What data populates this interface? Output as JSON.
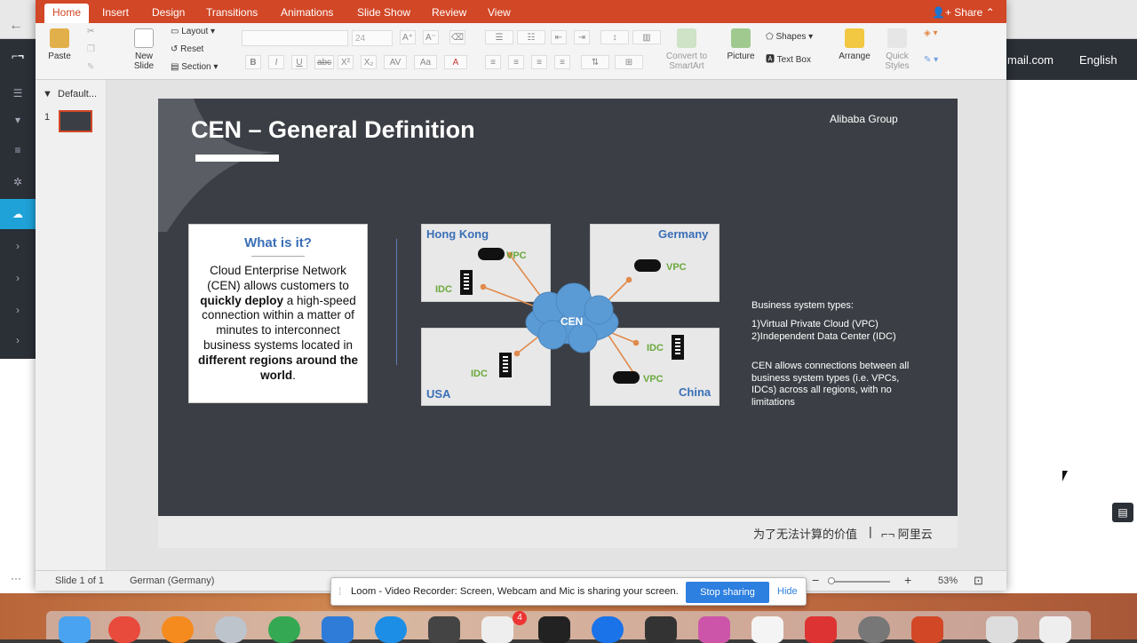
{
  "browser": {
    "nav_right": [
      "mail.com",
      "English"
    ],
    "email_text": "mail.com",
    "lang_text": "English"
  },
  "ppt": {
    "tabs": [
      "Home",
      "Insert",
      "Design",
      "Transitions",
      "Animations",
      "Slide Show",
      "Review",
      "View"
    ],
    "share_label": "Share",
    "ribbon": {
      "paste": "Paste",
      "new_slide": "New\nSlide",
      "layout": "Layout",
      "reset": "Reset",
      "section": "Section",
      "font_size": "24",
      "convert": "Convert to\nSmartArt",
      "picture": "Picture",
      "shapes": "Shapes",
      "textbox": "Text Box",
      "arrange": "Arrange",
      "quick_styles": "Quick\nStyles"
    },
    "thumb_section": "Default...",
    "thumb_num": "1",
    "status": {
      "slide": "Slide 1 of 1",
      "lang": "German (Germany)",
      "zoom": "53%"
    }
  },
  "slide": {
    "title": "CEN – General Definition",
    "logo": "Alibaba Group",
    "what_title": "What is it?",
    "what_body_1": "Cloud Enterprise Network (CEN) allows customers to ",
    "what_bold_1": "quickly deploy",
    "what_body_2": " a high-speed connection within a matter of minutes to interconnect business systems located in ",
    "what_bold_2": "different regions around the world",
    "what_body_3": ".",
    "regions": {
      "hk": "Hong Kong",
      "de": "Germany",
      "us": "USA",
      "cn": "China"
    },
    "vpc": "VPC",
    "idc": "IDC",
    "cen": "CEN",
    "types_title": "Business system types:",
    "type_1": "1)Virtual Private Cloud (VPC)",
    "type_2": "2)Independent Data Center (IDC)",
    "allow_text": "CEN allows connections between all business system types (i.e. VPCs, IDCs) across all regions, with no limitations",
    "footer_cn": "为了无法计算的价值",
    "footer_logo": "阿里云"
  },
  "toast": {
    "text": "Loom - Video Recorder: Screen, Webcam and Mic is sharing your screen.",
    "stop": "Stop sharing",
    "hide": "Hide"
  },
  "dock_badge": "4"
}
